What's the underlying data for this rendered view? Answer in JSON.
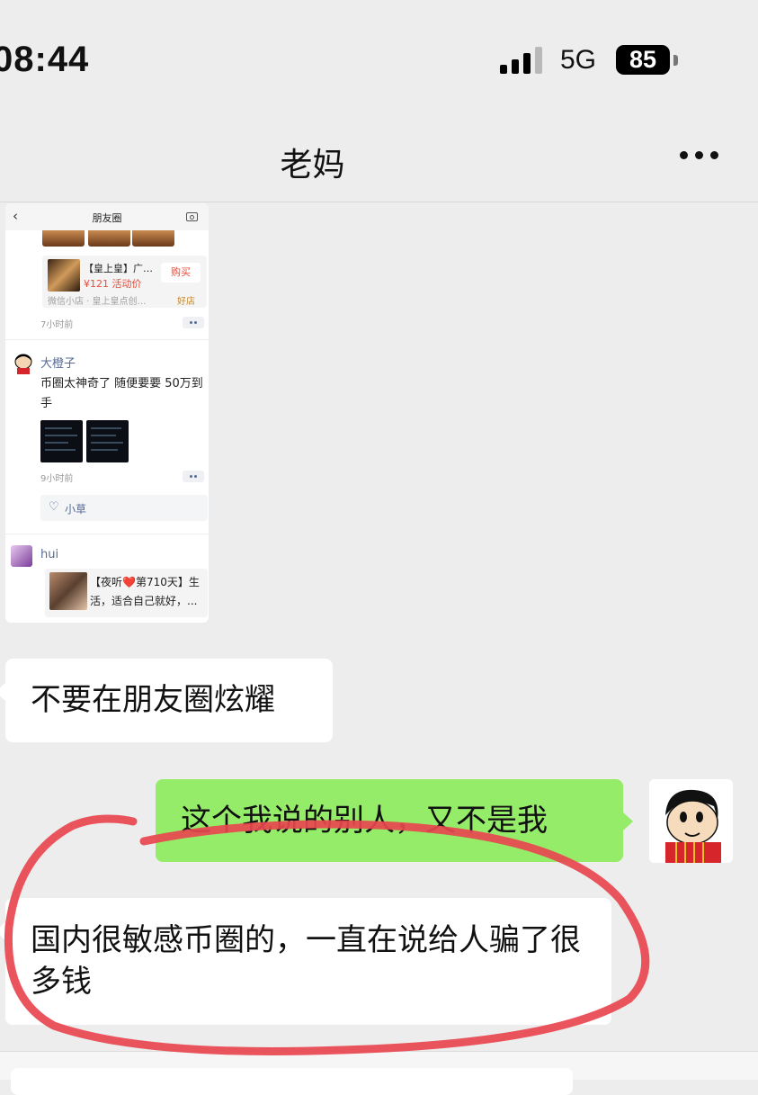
{
  "status_bar": {
    "time": "08:44",
    "network": "5G",
    "battery": "85"
  },
  "header": {
    "title": "老妈",
    "more_icon": "more-dots-icon"
  },
  "shared_screenshot": {
    "topbar_title": "朋友圈",
    "back_icon": "chevron-left-icon",
    "camera_icon": "camera-icon",
    "product": {
      "name": "【皇上皇】广…",
      "price": "¥121 活动价",
      "buy_label": "购买",
      "shop": "微信小店 · 皇上皇点创…",
      "tag": "好店"
    },
    "post1_time": "7小时前",
    "post2": {
      "author": "大橙子",
      "text": "币圈太神奇了 随便要要 50万到手",
      "time": "9小时前",
      "like_name": "小草"
    },
    "post3": {
      "author": "hui",
      "share_text": "【夜听❤️第710天】生活，适合自己就好，..."
    }
  },
  "messages": [
    {
      "side": "received",
      "text": "不要在朋友圈炫耀"
    },
    {
      "side": "sent",
      "text": "这个我说的别人，又不是我"
    },
    {
      "side": "received",
      "text": "国内很敏感币圈的，一直在说给人骗了很多钱"
    }
  ],
  "colors": {
    "background": "#ededed",
    "sent_bubble": "#95ec69",
    "received_bubble": "#ffffff",
    "link_blue": "#576b95",
    "annotation_red": "#e8474f"
  }
}
